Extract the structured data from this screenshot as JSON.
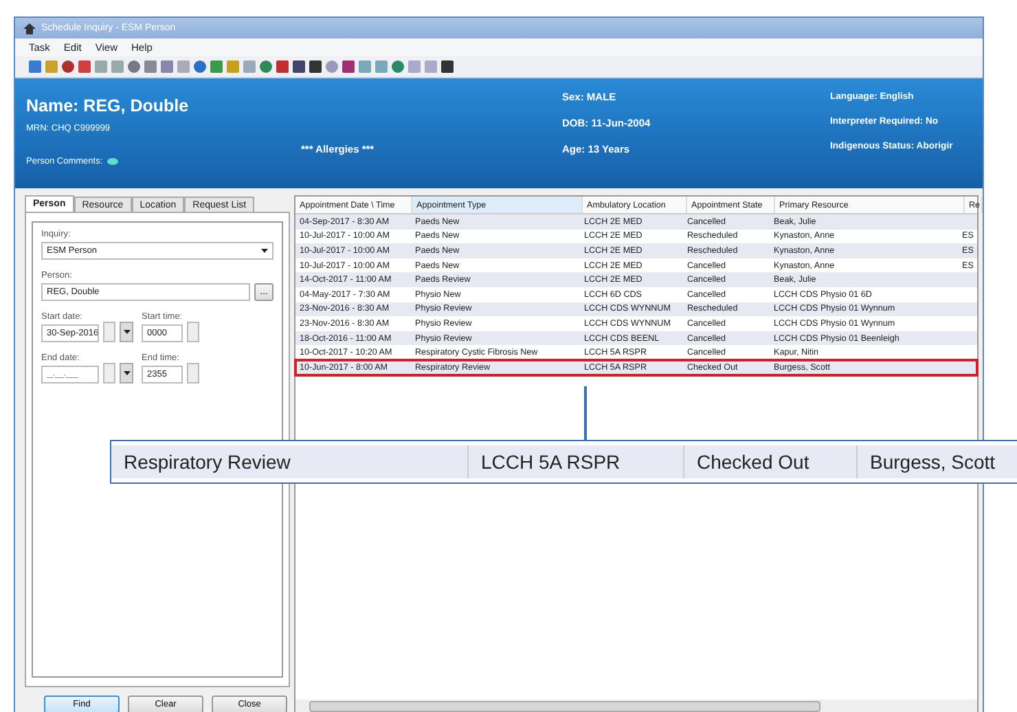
{
  "window": {
    "title": "Schedule Inquiry - ESM Person"
  },
  "menu": [
    "Task",
    "Edit",
    "View",
    "Help"
  ],
  "header": {
    "name": "Name: REG, Double",
    "mrn": "MRN: CHQ C999999",
    "allergies": "*** Allergies ***",
    "comments": "Person Comments:",
    "sex": "Sex: MALE",
    "dob": "DOB: 11-Jun-2004",
    "age": "Age:  13 Years",
    "language": "Language: English",
    "interpreter": "Interpreter Required: No",
    "indigenous": "Indigenous Status: Aborigir"
  },
  "tabs": [
    {
      "label": "Person",
      "selected": true
    },
    {
      "label": "Resource",
      "selected": false
    },
    {
      "label": "Location",
      "selected": false
    },
    {
      "label": "Request List",
      "selected": false
    }
  ],
  "form": {
    "inquiry_label": "Inquiry:",
    "inquiry": "ESM Person",
    "person_label": "Person:",
    "person": "REG, Double",
    "browse": "...",
    "start_date_label": "Start date:",
    "start_date": "30-Sep-2016",
    "start_time_label": "Start time:",
    "start_time": "0000",
    "end_date_label": "End date:",
    "end_date": "__-___-____",
    "end_time_label": "End time:",
    "end_time": "2355"
  },
  "buttons": [
    "Find",
    "Clear",
    "Close"
  ],
  "table": {
    "columns": [
      {
        "label": "Appointment Date \\ Time",
        "sorted": false
      },
      {
        "label": "Appointment Type",
        "sorted": true
      },
      {
        "label": "Ambulatory Location",
        "sorted": false
      },
      {
        "label": "Appointment State",
        "sorted": false
      },
      {
        "label": "Primary Resource",
        "sorted": false
      },
      {
        "label": "Re",
        "sorted": false
      }
    ],
    "rows": [
      {
        "cells": [
          "04-Sep-2017 - 8:30 AM",
          "Paeds New",
          "LCCH 2E MED",
          "Cancelled",
          "Beak, Julie",
          ""
        ],
        "selected": false
      },
      {
        "cells": [
          "10-Jul-2017 - 10:00 AM",
          "Paeds New",
          "LCCH 2E MED",
          "Rescheduled",
          "Kynaston, Anne",
          "ES"
        ],
        "selected": false
      },
      {
        "cells": [
          "10-Jul-2017 - 10:00 AM",
          "Paeds New",
          "LCCH 2E MED",
          "Rescheduled",
          "Kynaston, Anne",
          "ES"
        ],
        "selected": false
      },
      {
        "cells": [
          "10-Jul-2017 - 10:00 AM",
          "Paeds New",
          "LCCH 2E MED",
          "Cancelled",
          "Kynaston, Anne",
          "ES"
        ],
        "selected": false
      },
      {
        "cells": [
          "14-Oct-2017 - 11:00 AM",
          "Paeds Review",
          "LCCH 2E MED",
          "Cancelled",
          "Beak, Julie",
          ""
        ],
        "selected": false
      },
      {
        "cells": [
          "04-May-2017 - 7:30 AM",
          "Physio New",
          "LCCH 6D CDS",
          "Cancelled",
          "LCCH CDS Physio 01 6D",
          ""
        ],
        "selected": false
      },
      {
        "cells": [
          "23-Nov-2016 - 8:30 AM",
          "Physio Review",
          "LCCH CDS WYNNUM",
          "Rescheduled",
          "LCCH CDS Physio 01 Wynnum",
          ""
        ],
        "selected": false
      },
      {
        "cells": [
          "23-Nov-2016 - 8:30 AM",
          "Physio Review",
          "LCCH CDS WYNNUM",
          "Cancelled",
          "LCCH CDS Physio 01 Wynnum",
          ""
        ],
        "selected": false
      },
      {
        "cells": [
          "18-Oct-2016 - 11:00 AM",
          "Physio Review",
          "LCCH CDS BEENL",
          "Cancelled",
          "LCCH CDS Physio 01 Beenleigh",
          ""
        ],
        "selected": false
      },
      {
        "cells": [
          "10-Oct-2017 - 10:20 AM",
          "Respiratory Cystic Fibrosis New",
          "LCCH 5A RSPR",
          "Cancelled",
          "Kapur, Nitin",
          ""
        ],
        "selected": false
      },
      {
        "cells": [
          "10-Jun-2017 - 8:00 AM",
          "Respiratory Review",
          "LCCH 5A RSPR",
          "Checked Out",
          "Burgess, Scott",
          ""
        ],
        "selected": true
      }
    ]
  },
  "callout": {
    "cells": [
      "Respiratory Review",
      "LCCH 5A RSPR",
      "Checked Out",
      "Burgess, Scott"
    ]
  }
}
